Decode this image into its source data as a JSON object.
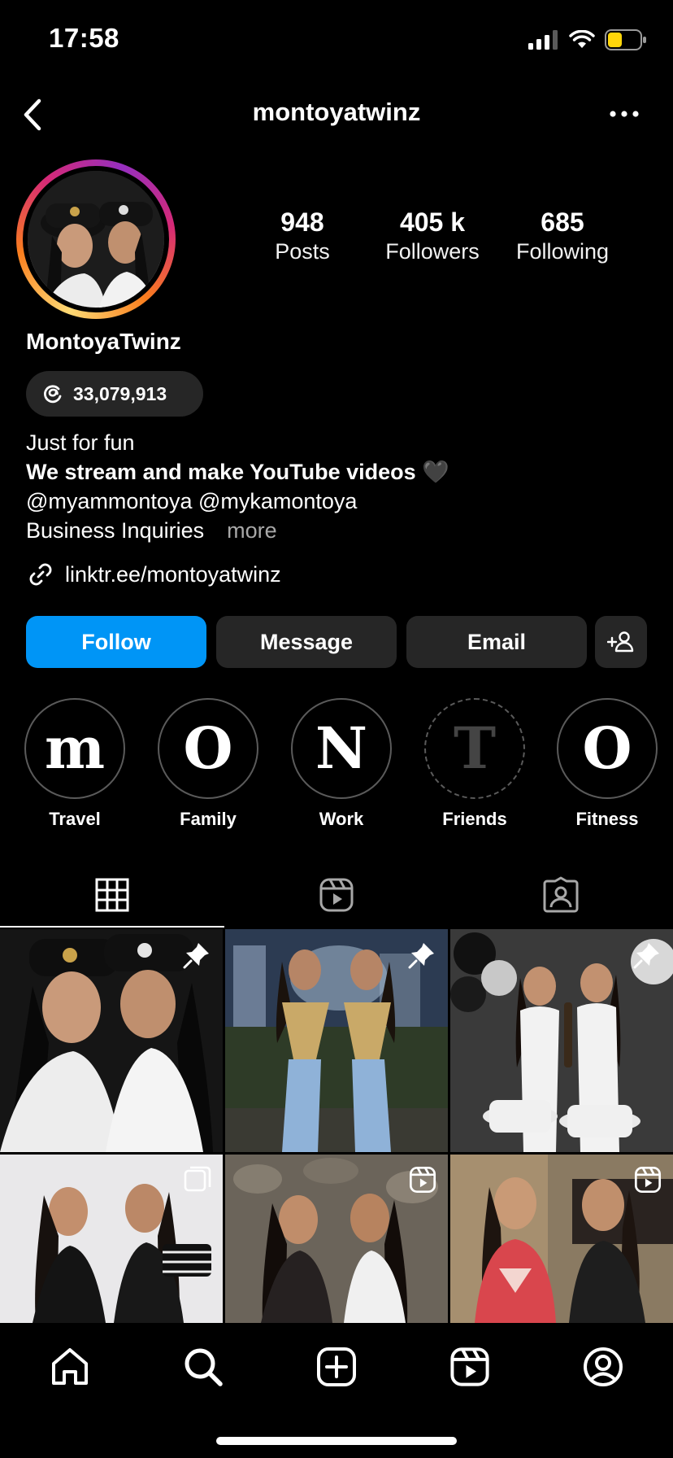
{
  "status": {
    "time": "17:58"
  },
  "header": {
    "title": "montoyatwinz",
    "back_icon": "chevron-left-icon",
    "more_icon": "ellipsis-icon"
  },
  "profile": {
    "stats": [
      {
        "value": "948",
        "label": "Posts"
      },
      {
        "value": "405 k",
        "label": "Followers"
      },
      {
        "value": "685",
        "label": "Following"
      }
    ],
    "display_name": "MontoyaTwinz",
    "threads_count": "33,079,913",
    "bio": {
      "line1": "Just for fun",
      "line2": "We stream and make YouTube videos 🖤",
      "line3": "@myammontoya @mykamontoya",
      "line4": "Business Inquiries",
      "more": "more"
    },
    "link": "linktr.ee/montoyatwinz"
  },
  "actions": {
    "follow": "Follow",
    "message": "Message",
    "email": "Email"
  },
  "highlights": [
    {
      "letter": "m",
      "label": "Travel"
    },
    {
      "letter": "O",
      "label": "Family"
    },
    {
      "letter": "N",
      "label": "Work"
    },
    {
      "letter": "T",
      "label": "Friends"
    },
    {
      "letter": "O",
      "label": "Fitness"
    }
  ],
  "colors": {
    "accent": "#0095f6",
    "button_bg": "#262626",
    "background": "#000000"
  }
}
